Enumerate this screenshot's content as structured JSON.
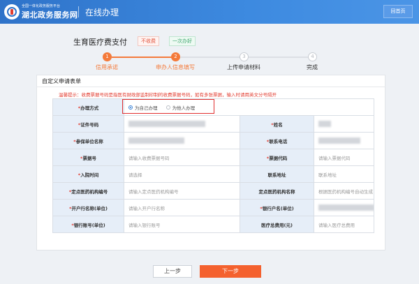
{
  "header": {
    "site_sub": "全国一体化政务服务平台",
    "site_name": "湖北政务服务网",
    "title": "在线办理",
    "home_label": "回首页"
  },
  "page": {
    "title": "生育医疗费支付",
    "tag_fee": "不收费",
    "tag_once": "一次办好"
  },
  "steps": [
    {
      "num": "1",
      "label": "信用承诺",
      "state": "done"
    },
    {
      "num": "2",
      "label": "申办人信息填写",
      "state": "active"
    },
    {
      "num": "3",
      "label": "上传申请材料",
      "state": "pending"
    },
    {
      "num": "4",
      "label": "完成",
      "state": "pending"
    }
  ],
  "form": {
    "title": "自定义申请表单",
    "tip": "温馨提示：收费票据号码是指医有财政部监制印制的收费票据号码，如有多张票据，输入时请用英文分号隔开",
    "required_mark": "*",
    "apply_method": {
      "label": "办理方式",
      "option_self": "为自己办理",
      "option_other": "为他人办理",
      "selected": "self"
    },
    "rows": [
      {
        "l1": "证件号码",
        "r1": true,
        "v1": "",
        "b1": 110,
        "l2": "姓名",
        "r2": true,
        "v2": "",
        "b2": 18
      },
      {
        "l1": "参保单位名称",
        "r1": true,
        "v1": "",
        "b1": 80,
        "l2": "联系电话",
        "r2": true,
        "v2": "",
        "b2": 60
      },
      {
        "l1": "票据号",
        "r1": true,
        "v1": "请输入收费票据号码",
        "l2": "票据代码",
        "r2": true,
        "v2": "请输入票据代码"
      },
      {
        "l1": "入院时间",
        "r1": true,
        "v1": "请选择",
        "l2": "联系地址",
        "r2": false,
        "v2": "联系地址"
      },
      {
        "l1": "定点医药机构编号",
        "r1": true,
        "v1": "请输入定点医药机构编号",
        "l2": "定点医药机构名称",
        "r2": false,
        "v2": "根据医药机构编号自动生成"
      },
      {
        "l1": "开户行名称(单位)",
        "r1": true,
        "v1": "请输入开户行名称",
        "l2": "银行户名(单位)",
        "r2": true,
        "v2": "",
        "b2": 80
      },
      {
        "l1": "银行账号(单位)",
        "r1": true,
        "v1": "请输入银行账号",
        "l2": "医疗总费用(元)",
        "r2": false,
        "v2": "请输入医疗总费用"
      }
    ]
  },
  "buttons": {
    "prev": "上一步",
    "next": "下一步"
  },
  "colors": {
    "header_blue": "#2f73c9",
    "accent_orange": "#f47a3a",
    "next_button": "#f4612e",
    "required_red": "#e23b2e",
    "label_bg": "#e6eef8"
  }
}
